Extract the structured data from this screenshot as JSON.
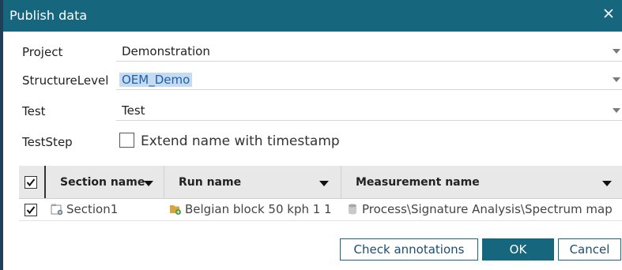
{
  "dialog": {
    "title": "Publish data",
    "close_icon": "close-icon"
  },
  "form": {
    "project": {
      "label": "Project",
      "value": "Demonstration"
    },
    "structure_level": {
      "label": "StructureLevel",
      "value": "OEM_Demo"
    },
    "test": {
      "label": "Test",
      "value": "Test"
    },
    "test_step": {
      "label": "TestStep",
      "checkbox_label": "Extend name with timestamp",
      "checked": false
    }
  },
  "grid": {
    "select_all_checked": true,
    "columns": [
      {
        "label": "Section name",
        "sort_icon": "sort-desc-icon"
      },
      {
        "label": "Run name",
        "sort_icon": "dropdown-icon"
      },
      {
        "label": "Measurement name",
        "sort_icon": "dropdown-icon"
      }
    ],
    "rows": [
      {
        "checked": true,
        "section": {
          "icon": "section-icon",
          "text": "Section1"
        },
        "run": {
          "icon": "run-folder-icon",
          "text": "Belgian block 50 kph 1 1"
        },
        "measurement": {
          "icon": "database-icon",
          "text": "Process\\Signature Analysis\\Spectrum map"
        }
      }
    ]
  },
  "buttons": {
    "check_annotations": "Check annotations",
    "ok": "OK",
    "cancel": "Cancel"
  },
  "colors": {
    "titlebar": "#16667e",
    "selection_bg": "#c5dbef",
    "selection_text": "#1f5faa"
  }
}
